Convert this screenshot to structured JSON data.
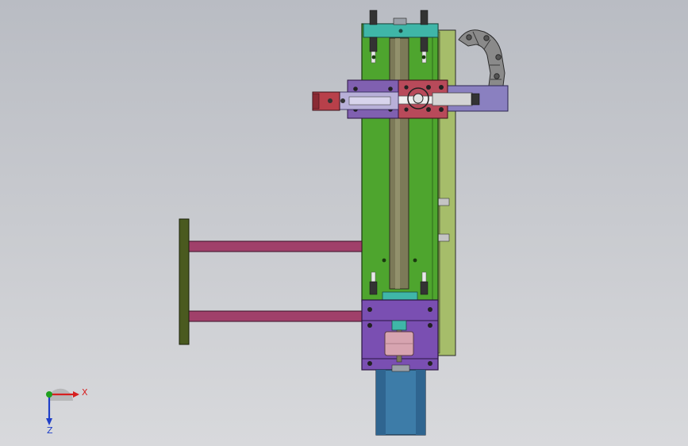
{
  "axes": {
    "x_label": "X",
    "z_label": "Z",
    "x_color": "#d62020",
    "z_color": "#1f3fc8",
    "y_color": "#1fa01f"
  },
  "colors": {
    "background_top": "#b9bcc3",
    "background_bottom": "#d8d9dc",
    "column_green": "#4ea52e",
    "back_plate": "#a6bd6a",
    "top_plate_cyan": "#3fb6a8",
    "carriage_purple": "#8060b0",
    "carriage_red": "#b84a5a",
    "cylinder_red": "#b8404a",
    "rod_pink": "#a0406a",
    "end_plate_olive": "#4a5a1f",
    "lower_block_purple": "#7a4fb2",
    "coupling_pink": "#d7a4b0",
    "motor_blue": "#3d7ca8",
    "cable_chain": "#8a8a8a",
    "bracket_lavender": "#8a80c0"
  },
  "icons": {
    "triad": "axis-triad-icon",
    "cable_chain": "cable-chain-icon",
    "motor": "servo-motor-icon"
  }
}
